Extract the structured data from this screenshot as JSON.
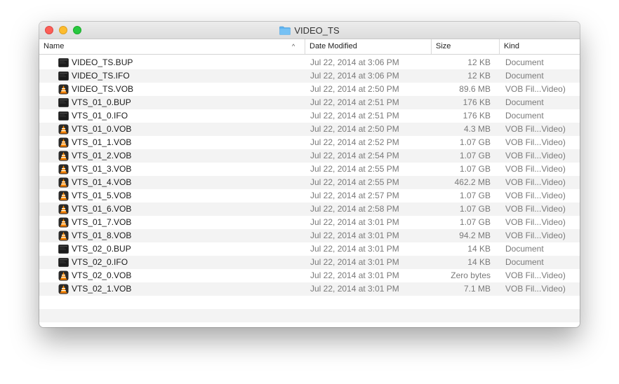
{
  "window": {
    "title": "VIDEO_TS"
  },
  "columns": {
    "name": "Name",
    "date": "Date Modified",
    "size": "Size",
    "kind": "Kind"
  },
  "files": [
    {
      "name": "VIDEO_TS.BUP",
      "date": "Jul 22, 2014 at 3:06 PM",
      "size": "12 KB",
      "kind": "Document",
      "icon": "document-icon"
    },
    {
      "name": "VIDEO_TS.IFO",
      "date": "Jul 22, 2014 at 3:06 PM",
      "size": "12 KB",
      "kind": "Document",
      "icon": "document-icon"
    },
    {
      "name": "VIDEO_TS.VOB",
      "date": "Jul 22, 2014 at 2:50 PM",
      "size": "89.6 MB",
      "kind": "VOB Fil...Video)",
      "icon": "vlc-cone-icon"
    },
    {
      "name": "VTS_01_0.BUP",
      "date": "Jul 22, 2014 at 2:51 PM",
      "size": "176 KB",
      "kind": "Document",
      "icon": "document-icon"
    },
    {
      "name": "VTS_01_0.IFO",
      "date": "Jul 22, 2014 at 2:51 PM",
      "size": "176 KB",
      "kind": "Document",
      "icon": "document-icon"
    },
    {
      "name": "VTS_01_0.VOB",
      "date": "Jul 22, 2014 at 2:50 PM",
      "size": "4.3 MB",
      "kind": "VOB Fil...Video)",
      "icon": "vlc-cone-icon"
    },
    {
      "name": "VTS_01_1.VOB",
      "date": "Jul 22, 2014 at 2:52 PM",
      "size": "1.07 GB",
      "kind": "VOB Fil...Video)",
      "icon": "vlc-cone-icon"
    },
    {
      "name": "VTS_01_2.VOB",
      "date": "Jul 22, 2014 at 2:54 PM",
      "size": "1.07 GB",
      "kind": "VOB Fil...Video)",
      "icon": "vlc-cone-icon"
    },
    {
      "name": "VTS_01_3.VOB",
      "date": "Jul 22, 2014 at 2:55 PM",
      "size": "1.07 GB",
      "kind": "VOB Fil...Video)",
      "icon": "vlc-cone-icon"
    },
    {
      "name": "VTS_01_4.VOB",
      "date": "Jul 22, 2014 at 2:55 PM",
      "size": "462.2 MB",
      "kind": "VOB Fil...Video)",
      "icon": "vlc-cone-icon"
    },
    {
      "name": "VTS_01_5.VOB",
      "date": "Jul 22, 2014 at 2:57 PM",
      "size": "1.07 GB",
      "kind": "VOB Fil...Video)",
      "icon": "vlc-cone-icon"
    },
    {
      "name": "VTS_01_6.VOB",
      "date": "Jul 22, 2014 at 2:58 PM",
      "size": "1.07 GB",
      "kind": "VOB Fil...Video)",
      "icon": "vlc-cone-icon"
    },
    {
      "name": "VTS_01_7.VOB",
      "date": "Jul 22, 2014 at 3:01 PM",
      "size": "1.07 GB",
      "kind": "VOB Fil...Video)",
      "icon": "vlc-cone-icon"
    },
    {
      "name": "VTS_01_8.VOB",
      "date": "Jul 22, 2014 at 3:01 PM",
      "size": "94.2 MB",
      "kind": "VOB Fil...Video)",
      "icon": "vlc-cone-icon"
    },
    {
      "name": "VTS_02_0.BUP",
      "date": "Jul 22, 2014 at 3:01 PM",
      "size": "14 KB",
      "kind": "Document",
      "icon": "document-icon"
    },
    {
      "name": "VTS_02_0.IFO",
      "date": "Jul 22, 2014 at 3:01 PM",
      "size": "14 KB",
      "kind": "Document",
      "icon": "document-icon"
    },
    {
      "name": "VTS_02_0.VOB",
      "date": "Jul 22, 2014 at 3:01 PM",
      "size": "Zero bytes",
      "kind": "VOB Fil...Video)",
      "icon": "vlc-cone-icon"
    },
    {
      "name": "VTS_02_1.VOB",
      "date": "Jul 22, 2014 at 3:01 PM",
      "size": "7.1 MB",
      "kind": "VOB Fil...Video)",
      "icon": "vlc-cone-icon"
    }
  ],
  "empty_rows": 2
}
